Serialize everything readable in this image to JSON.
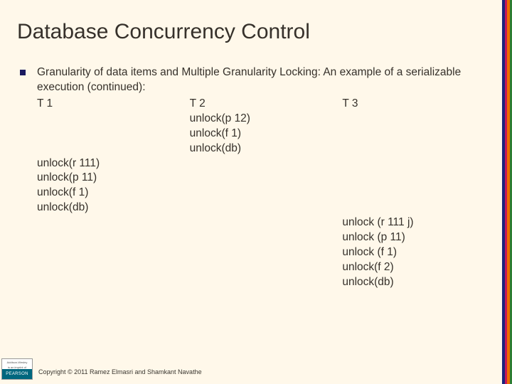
{
  "title": "Database Concurrency Control",
  "intro": "Granularity of data items and Multiple Granularity Locking: An example of a serializable execution (continued):",
  "columns": {
    "t1": {
      "header": "T 1"
    },
    "t2": {
      "header": "T 2"
    },
    "t3": {
      "header": "T 3"
    }
  },
  "t2_ops": {
    "l1": "unlock(p 12)",
    "l2": "unlock(f 1)",
    "l3": "unlock(db)"
  },
  "t1_ops": {
    "l1": "unlock(r 111)",
    "l2": "unlock(p 11)",
    "l3": "unlock(f 1)",
    "l4": "unlock(db)"
  },
  "t3_ops": {
    "l1": "unlock (r 111 j)",
    "l2": "unlock (p 11)",
    "l3": "unlock (f 1)",
    "l4": "unlock(f 2)",
    "l5": "unlock(db)"
  },
  "logo": {
    "top1": "Addison-Wesley",
    "top2": "is an imprint of",
    "bottom": "PEARSON"
  },
  "copyright": "Copyright © 2011 Ramez Elmasri and Shamkant Navathe"
}
